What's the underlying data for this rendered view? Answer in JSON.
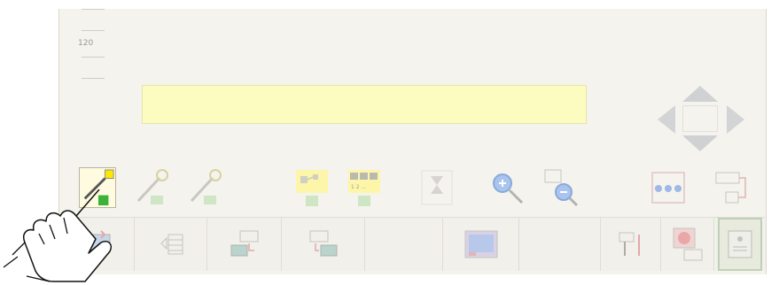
{
  "ruler": {
    "label": "120"
  },
  "colors": {
    "panel": "#f4f3ee",
    "display": "#fcfcc0",
    "active_tool": "#fffbe0",
    "accent_green": "#3bb33b",
    "accent_blue": "#7aa0d8"
  },
  "toolbar": {
    "tools": [
      {
        "icon": "pen-select-icon",
        "state": "active"
      },
      {
        "icon": "pen-add-icon",
        "state": "disabled"
      },
      {
        "icon": "pen-draw-icon",
        "state": "disabled"
      },
      {
        "icon": "node-add-icon",
        "state": "disabled"
      },
      {
        "icon": "grid-add-icon",
        "state": "disabled",
        "labels": [
          "1",
          "2",
          "N"
        ]
      },
      {
        "icon": "delete-icon",
        "state": "disabled"
      },
      {
        "icon": "zoom-in-icon",
        "state": "disabled"
      },
      {
        "icon": "zoom-out-icon",
        "state": "disabled"
      },
      {
        "icon": "fit-icon",
        "state": "disabled"
      },
      {
        "icon": "export-icon",
        "state": "disabled"
      }
    ]
  },
  "bottom_bar": {
    "items": [
      "monitor-download-icon",
      "table-view-icon",
      "transfer-icon",
      "network-transfer-icon",
      "empty-slot",
      "screen-preview-icon",
      "empty-slot",
      "device-tools-icon",
      "record-icon",
      "hardware-module-icon"
    ]
  },
  "navigation": {
    "up": "arrow-up-icon",
    "down": "arrow-down-icon",
    "left": "arrow-left-icon",
    "right": "arrow-right-icon"
  },
  "cursor": {
    "icon": "hand-pointer-icon"
  }
}
